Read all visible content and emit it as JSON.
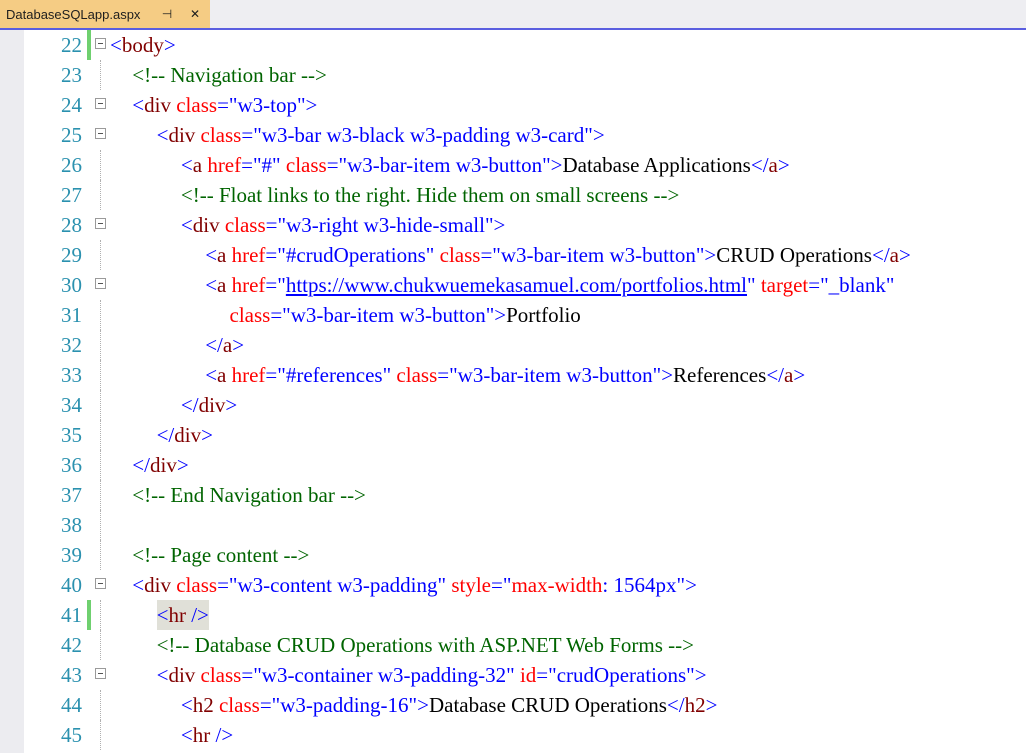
{
  "tab": {
    "title": "DatabaseSQLapp.aspx",
    "pin_glyph": "⊣",
    "close_glyph": "✕"
  },
  "colors": {
    "tab_active": "#f5cc84",
    "tab_border": "#5a5ee0",
    "line_number": "#2b91af",
    "tag": "#800000",
    "attribute": "#ff0000",
    "value": "#0000ff",
    "comment": "#006400",
    "change_bar": "#6fd06f"
  },
  "lines": [
    {
      "n": "22",
      "indent": 0,
      "fold": true,
      "change": true,
      "tokens": [
        [
          "t-bracket",
          "<"
        ],
        [
          "t-tag",
          "body"
        ],
        [
          "t-bracket",
          ">"
        ]
      ]
    },
    {
      "n": "23",
      "indent": 1,
      "fold": false,
      "tokens": [
        [
          "t-comment",
          "<!-- Navigation bar -->"
        ]
      ]
    },
    {
      "n": "24",
      "indent": 1,
      "fold": true,
      "tokens": [
        [
          "t-bracket",
          "<"
        ],
        [
          "t-tag",
          "div"
        ],
        [
          "t-text",
          " "
        ],
        [
          "t-attr",
          "class"
        ],
        [
          "t-bracket",
          "="
        ],
        [
          "t-val",
          "\"w3-top\""
        ],
        [
          "t-bracket",
          ">"
        ]
      ]
    },
    {
      "n": "25",
      "indent": 2,
      "fold": true,
      "tokens": [
        [
          "t-bracket",
          "<"
        ],
        [
          "t-tag",
          "div"
        ],
        [
          "t-text",
          " "
        ],
        [
          "t-attr",
          "class"
        ],
        [
          "t-bracket",
          "="
        ],
        [
          "t-val",
          "\"w3-bar w3-black w3-padding w3-card\""
        ],
        [
          "t-bracket",
          ">"
        ]
      ]
    },
    {
      "n": "26",
      "indent": 3,
      "fold": false,
      "tokens": [
        [
          "t-bracket",
          "<"
        ],
        [
          "t-tag",
          "a"
        ],
        [
          "t-text",
          " "
        ],
        [
          "t-attr",
          "href"
        ],
        [
          "t-bracket",
          "="
        ],
        [
          "t-val",
          "\"#\""
        ],
        [
          "t-text",
          " "
        ],
        [
          "t-attr",
          "class"
        ],
        [
          "t-bracket",
          "="
        ],
        [
          "t-val",
          "\"w3-bar-item w3-button\""
        ],
        [
          "t-bracket",
          ">"
        ],
        [
          "t-text",
          "Database Applications"
        ],
        [
          "t-bracket",
          "</"
        ],
        [
          "t-tag",
          "a"
        ],
        [
          "t-bracket",
          ">"
        ]
      ]
    },
    {
      "n": "27",
      "indent": 3,
      "fold": false,
      "tokens": [
        [
          "t-comment",
          "<!-- Float links to the right. Hide them on small screens -->"
        ]
      ]
    },
    {
      "n": "28",
      "indent": 3,
      "fold": true,
      "tokens": [
        [
          "t-bracket",
          "<"
        ],
        [
          "t-tag",
          "div"
        ],
        [
          "t-text",
          " "
        ],
        [
          "t-attr",
          "class"
        ],
        [
          "t-bracket",
          "="
        ],
        [
          "t-val",
          "\"w3-right w3-hide-small\""
        ],
        [
          "t-bracket",
          ">"
        ]
      ]
    },
    {
      "n": "29",
      "indent": 4,
      "fold": false,
      "tokens": [
        [
          "t-bracket",
          "<"
        ],
        [
          "t-tag",
          "a"
        ],
        [
          "t-text",
          " "
        ],
        [
          "t-attr",
          "href"
        ],
        [
          "t-bracket",
          "="
        ],
        [
          "t-val",
          "\"#crudOperations\""
        ],
        [
          "t-text",
          " "
        ],
        [
          "t-attr",
          "class"
        ],
        [
          "t-bracket",
          "="
        ],
        [
          "t-val",
          "\"w3-bar-item w3-button\""
        ],
        [
          "t-bracket",
          ">"
        ],
        [
          "t-text",
          "CRUD Operations"
        ],
        [
          "t-bracket",
          "</"
        ],
        [
          "t-tag",
          "a"
        ],
        [
          "t-bracket",
          ">"
        ]
      ]
    },
    {
      "n": "30",
      "indent": 4,
      "fold": true,
      "tokens": [
        [
          "t-bracket",
          "<"
        ],
        [
          "t-tag",
          "a"
        ],
        [
          "t-text",
          " "
        ],
        [
          "t-attr",
          "href"
        ],
        [
          "t-bracket",
          "=\""
        ],
        [
          "t-link",
          "https://www.chukwuemekasamuel.com/portfolios.html"
        ],
        [
          "t-bracket",
          "\""
        ],
        [
          "t-text",
          " "
        ],
        [
          "t-attr",
          "target"
        ],
        [
          "t-bracket",
          "="
        ],
        [
          "t-val",
          "\"_blank\""
        ]
      ]
    },
    {
      "n": "31",
      "indent": 5,
      "fold": false,
      "tokens": [
        [
          "t-attr",
          "class"
        ],
        [
          "t-bracket",
          "="
        ],
        [
          "t-val",
          "\"w3-bar-item w3-button\""
        ],
        [
          "t-bracket",
          ">"
        ],
        [
          "t-text",
          "Portfolio"
        ]
      ]
    },
    {
      "n": "32",
      "indent": 4,
      "fold": false,
      "tokens": [
        [
          "t-bracket",
          "</"
        ],
        [
          "t-tag",
          "a"
        ],
        [
          "t-bracket",
          ">"
        ]
      ]
    },
    {
      "n": "33",
      "indent": 4,
      "fold": false,
      "tokens": [
        [
          "t-bracket",
          "<"
        ],
        [
          "t-tag",
          "a"
        ],
        [
          "t-text",
          " "
        ],
        [
          "t-attr",
          "href"
        ],
        [
          "t-bracket",
          "="
        ],
        [
          "t-val",
          "\"#references\""
        ],
        [
          "t-text",
          " "
        ],
        [
          "t-attr",
          "class"
        ],
        [
          "t-bracket",
          "="
        ],
        [
          "t-val",
          "\"w3-bar-item w3-button\""
        ],
        [
          "t-bracket",
          ">"
        ],
        [
          "t-text",
          "References"
        ],
        [
          "t-bracket",
          "</"
        ],
        [
          "t-tag",
          "a"
        ],
        [
          "t-bracket",
          ">"
        ]
      ]
    },
    {
      "n": "34",
      "indent": 3,
      "fold": false,
      "tokens": [
        [
          "t-bracket",
          "</"
        ],
        [
          "t-tag",
          "div"
        ],
        [
          "t-bracket",
          ">"
        ]
      ]
    },
    {
      "n": "35",
      "indent": 2,
      "fold": false,
      "tokens": [
        [
          "t-bracket",
          "</"
        ],
        [
          "t-tag",
          "div"
        ],
        [
          "t-bracket",
          ">"
        ]
      ]
    },
    {
      "n": "36",
      "indent": 1,
      "fold": false,
      "tokens": [
        [
          "t-bracket",
          "</"
        ],
        [
          "t-tag",
          "div"
        ],
        [
          "t-bracket",
          ">"
        ]
      ]
    },
    {
      "n": "37",
      "indent": 1,
      "fold": false,
      "tokens": [
        [
          "t-comment",
          "<!-- End Navigation bar -->"
        ]
      ]
    },
    {
      "n": "38",
      "indent": 0,
      "fold": false,
      "tokens": []
    },
    {
      "n": "39",
      "indent": 1,
      "fold": false,
      "tokens": [
        [
          "t-comment",
          "<!-- Page content -->"
        ]
      ]
    },
    {
      "n": "40",
      "indent": 1,
      "fold": true,
      "tokens": [
        [
          "t-bracket",
          "<"
        ],
        [
          "t-tag",
          "div"
        ],
        [
          "t-text",
          " "
        ],
        [
          "t-attr",
          "class"
        ],
        [
          "t-bracket",
          "="
        ],
        [
          "t-val",
          "\"w3-content w3-padding\""
        ],
        [
          "t-text",
          " "
        ],
        [
          "t-attr",
          "style"
        ],
        [
          "t-bracket",
          "="
        ],
        [
          "t-val",
          "\""
        ],
        [
          "t-attr",
          "max-width"
        ],
        [
          "t-val",
          ": 1564px\""
        ],
        [
          "t-bracket",
          ">"
        ]
      ]
    },
    {
      "n": "41",
      "indent": 2,
      "fold": false,
      "change": true,
      "highlight": true,
      "tokens": [
        [
          "t-bracket",
          "<"
        ],
        [
          "t-tag",
          "hr"
        ],
        [
          "t-text",
          " "
        ],
        [
          "t-bracket",
          "/>"
        ]
      ]
    },
    {
      "n": "42",
      "indent": 2,
      "fold": false,
      "tokens": [
        [
          "t-comment",
          "<!-- Database CRUD Operations with ASP.NET Web Forms -->"
        ]
      ]
    },
    {
      "n": "43",
      "indent": 2,
      "fold": true,
      "tokens": [
        [
          "t-bracket",
          "<"
        ],
        [
          "t-tag",
          "div"
        ],
        [
          "t-text",
          " "
        ],
        [
          "t-attr",
          "class"
        ],
        [
          "t-bracket",
          "="
        ],
        [
          "t-val",
          "\"w3-container w3-padding-32\""
        ],
        [
          "t-text",
          " "
        ],
        [
          "t-attr",
          "id"
        ],
        [
          "t-bracket",
          "="
        ],
        [
          "t-val",
          "\"crudOperations\""
        ],
        [
          "t-bracket",
          ">"
        ]
      ]
    },
    {
      "n": "44",
      "indent": 3,
      "fold": false,
      "tokens": [
        [
          "t-bracket",
          "<"
        ],
        [
          "t-tag",
          "h2"
        ],
        [
          "t-text",
          " "
        ],
        [
          "t-attr",
          "class"
        ],
        [
          "t-bracket",
          "="
        ],
        [
          "t-val",
          "\"w3-padding-16\""
        ],
        [
          "t-bracket",
          ">"
        ],
        [
          "t-text",
          "Database CRUD Operations"
        ],
        [
          "t-bracket",
          "</"
        ],
        [
          "t-tag",
          "h2"
        ],
        [
          "t-bracket",
          ">"
        ]
      ]
    },
    {
      "n": "45",
      "indent": 3,
      "fold": false,
      "tokens": [
        [
          "t-bracket",
          "<"
        ],
        [
          "t-tag",
          "hr"
        ],
        [
          "t-text",
          " "
        ],
        [
          "t-bracket",
          "/>"
        ]
      ]
    }
  ]
}
